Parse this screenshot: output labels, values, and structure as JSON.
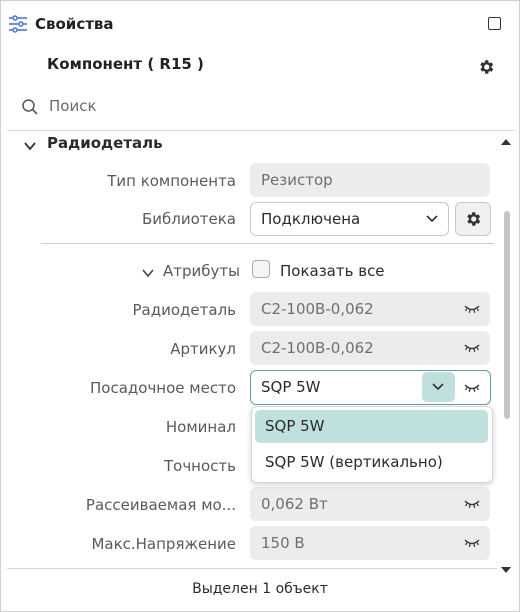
{
  "panel": {
    "title": "Свойства"
  },
  "component": {
    "title": "Компонент ( R15 )"
  },
  "search": {
    "placeholder": "Поиск"
  },
  "section": {
    "title": "Радиодеталь"
  },
  "fields": {
    "component_type": {
      "label": "Тип компонента",
      "value": "Резистор"
    },
    "library": {
      "label": "Библиотека",
      "value": "Подключена"
    },
    "attributes": {
      "label": "Атрибуты",
      "show_all_label": "Показать все",
      "show_all_checked": false
    },
    "radiodetail": {
      "label": "Радиодеталь",
      "value": "С2-100В-0,062"
    },
    "article": {
      "label": "Артикул",
      "value": "С2-100В-0,062"
    },
    "footprint": {
      "label": "Посадочное место",
      "value": "SQP 5W"
    },
    "nominal": {
      "label": "Номинал"
    },
    "accuracy": {
      "label": "Точность"
    },
    "power": {
      "label": "Рассеиваемая мо...",
      "value": "0,062 Вт"
    },
    "max_voltage": {
      "label": "Макс.Напряжение",
      "value": "150 В"
    }
  },
  "footprint_options": [
    "SQP 5W",
    "SQP 5W (вертикально)"
  ],
  "status": {
    "text": "Выделен 1 объект"
  },
  "colors": {
    "accent": "#5aa39b",
    "selected_bg": "#bfe0dc",
    "field_bg": "#ececec"
  },
  "icons": [
    "sliders-icon",
    "maximize-icon",
    "gear-icon",
    "search-icon",
    "chevron-down-icon",
    "eye-closed-icon"
  ]
}
